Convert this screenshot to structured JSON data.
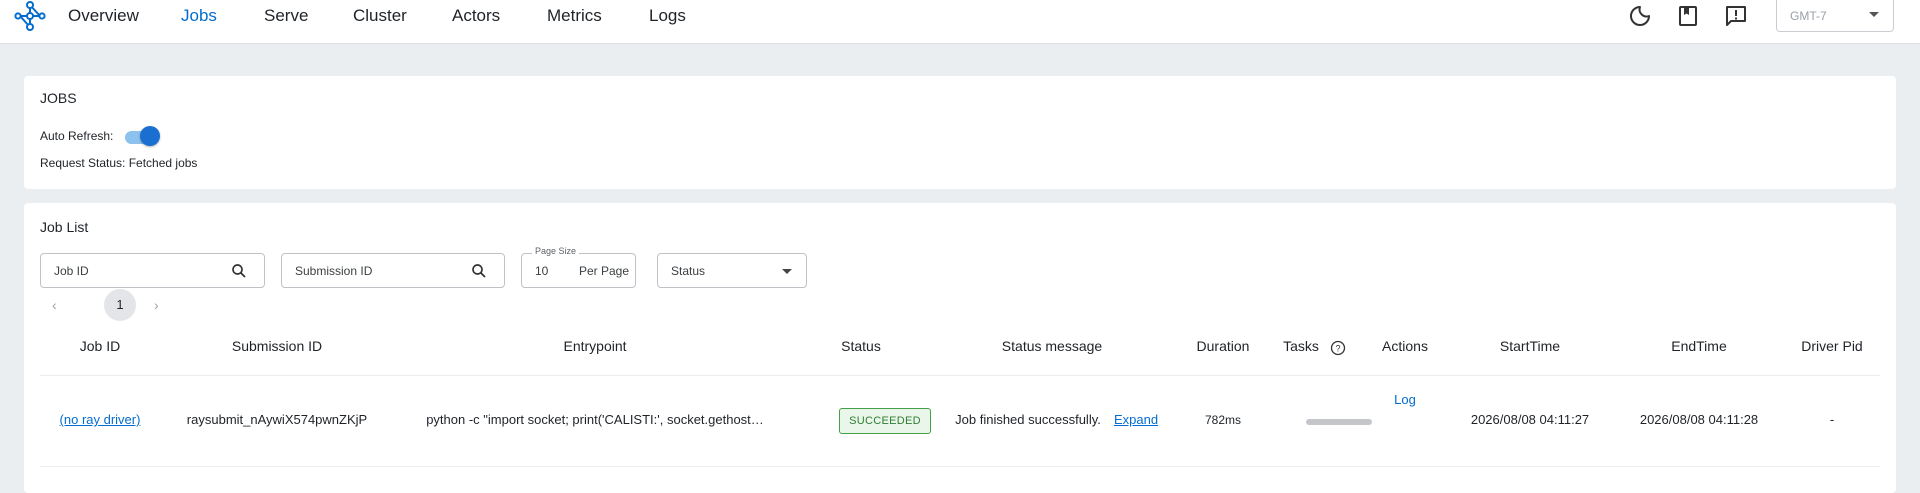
{
  "nav": {
    "items": [
      "Overview",
      "Jobs",
      "Serve",
      "Cluster",
      "Actors",
      "Metrics",
      "Logs"
    ],
    "active": "Jobs",
    "icons": [
      "ray-logo-icon",
      "dark-mode-moon-icon",
      "docs-book-icon",
      "feedback-icon"
    ],
    "timezone": "GMT-7"
  },
  "jobs_card": {
    "title": "JOBS",
    "auto_refresh_label": "Auto Refresh:",
    "auto_refresh_on": true,
    "request_status": "Request Status: Fetched jobs"
  },
  "job_list": {
    "title": "Job List",
    "filters": {
      "job_id_placeholder": "Job ID",
      "submission_id_placeholder": "Submission ID",
      "page_size_label": "Page Size",
      "page_size_value": "10",
      "page_size_suffix": "Per Page",
      "status_placeholder": "Status"
    },
    "pagination": {
      "current_page": "1",
      "prev": "‹",
      "next": "›"
    },
    "columns": [
      "Job ID",
      "Submission ID",
      "Entrypoint",
      "Status",
      "Status message",
      "Duration",
      "Tasks",
      "Actions",
      "StartTime",
      "EndTime",
      "Driver Pid"
    ],
    "rows": [
      {
        "job_id": "(no ray driver)",
        "submission_id": "raysubmit_nAywiX574pwnZKjP",
        "entrypoint": "python -c \"import socket; print('CALISTI:', socket.gethost…",
        "status": "SUCCEEDED",
        "status_message": "Job finished successfully.",
        "expand": "Expand",
        "duration": "782ms",
        "tasks_progress": 0,
        "action": "Log",
        "start_time": "2026/08/08 04:11:27",
        "end_time": "2026/08/08 04:11:28",
        "driver_pid": "-"
      }
    ]
  },
  "colors": {
    "accent": "#036dcf",
    "success": "#2e7d32",
    "background": "#ebeef1"
  }
}
